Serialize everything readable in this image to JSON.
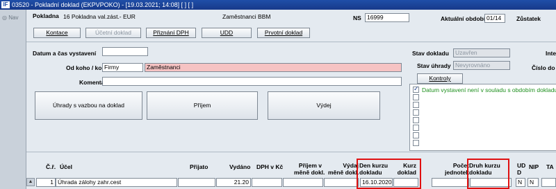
{
  "window": {
    "title": "03520 - Pokladní doklad (EKPVPOKO) - [19.03.2021; 14:08]  [ ]  [ ]"
  },
  "leftbar": {
    "nav_label": "Nav"
  },
  "header": {
    "pokladna_label": "Pokladna",
    "pokladna_value": "16 Pokladna val.zást.- EUR",
    "department_value": "Zaměstnanci BBM",
    "ns_label": "NS",
    "ns_value": "16999",
    "period_label": "Aktuální období",
    "period_value": "01/14",
    "zustatek_label": "Zůstatek"
  },
  "toolbar": {
    "kontace": "Kontace",
    "ucetni_doklad": "Účetní doklad",
    "priznani_dph": "Přiznání DPH",
    "udd": "UDD",
    "prvotni_doklad": "Prvotní doklad"
  },
  "form": {
    "datum_label": "Datum a čas vystavení",
    "datum_value": "",
    "od_koho_label": "Od koho / komu",
    "od_koho_type": "Firmy",
    "od_koho_value": "Zaměstnanci",
    "komentar_label": "Komentář",
    "komentar_value": ""
  },
  "status": {
    "stav_dokladu_label": "Stav dokladu",
    "stav_dokladu_value": "Uzavřen",
    "stav_uhrady_label": "Stav úhrady",
    "stav_uhrady_value": "Nevyrovnáno",
    "right_label_1": "Inte",
    "right_label_2": "Číslo do"
  },
  "actions": {
    "uhrady": "Úhrady s vazbou na doklad",
    "prijem": "Příjem",
    "vydej": "Výdej"
  },
  "kontroly": {
    "button": "Kontroly",
    "messages": [
      "Datum vystavení není v souladu s obdobím dokladu",
      "",
      "",
      "",
      "",
      "",
      "",
      ""
    ]
  },
  "table": {
    "headers": {
      "cr": "Č.ř.",
      "ucel": "Účel",
      "prijato": "Přijato",
      "vydano": "Vydáno",
      "dph": "DPH v Kč",
      "prijem_mene_1": "Příjem v",
      "prijem_mene_2": "měně dokl.",
      "vydaj_mene_1": "Výdaj",
      "vydaj_mene_2": "měně dokl.",
      "den_kurzu_1": "Den kurzu",
      "den_kurzu_2": "dokladu",
      "kurz_1": "Kurz",
      "kurz_2": "doklad",
      "pocet_1": "Počet",
      "pocet_2": "jednotek",
      "druh_kurzu_1": "Druh kurzu",
      "druh_kurzu_2": "dokladu",
      "udd_1": "UD",
      "udd_2": "D",
      "nip": "NIP",
      "ta": "TA"
    },
    "row": {
      "cr": "1",
      "ucel": "Úhrada zálohy zahr.cest",
      "prijato": "",
      "vydano": "21.20",
      "dph": "",
      "prijem_mene": "",
      "vydaj_mene": "",
      "den_kurzu": "16.10.2020",
      "kurz": "",
      "pocet": "",
      "druh_kurzu": "",
      "udd": "N",
      "nip": "N",
      "ta": ""
    }
  },
  "colors": {
    "titlebar": "#1f4fa8",
    "highlight_box": "#e01010",
    "warning_text": "#1d8f1d",
    "required_field": "#f6c3c3"
  }
}
